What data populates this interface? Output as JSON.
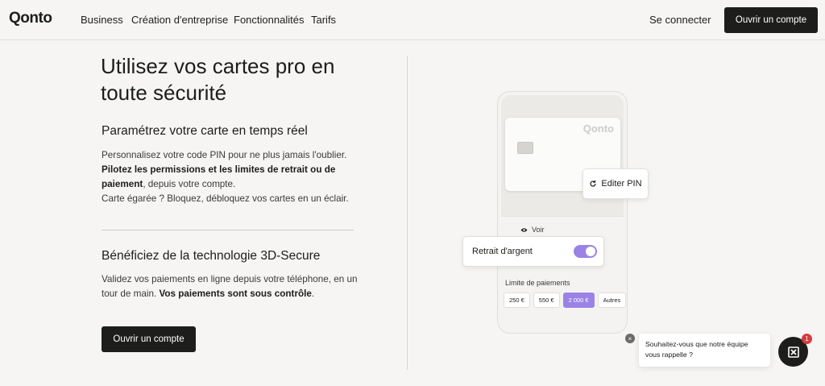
{
  "header": {
    "logo": "Qonto",
    "nav": [
      "Business",
      "Création d'entreprise",
      "Fonctionnalités",
      "Tarifs"
    ],
    "login": "Se connecter",
    "cta": "Ouvrir un compte"
  },
  "main": {
    "headline": "Utilisez vos cartes pro en toute sécurité",
    "section1": {
      "title": "Paramétrez votre carte en temps réel",
      "line1": "Personnalisez votre code PIN pour ne plus jamais l'oublier.",
      "bold": "Pilotez les permissions et les limites de retrait ou de paiement",
      "line2_rest": ", depuis votre compte.",
      "line3": "Carte égarée ? Bloquez, débloquez vos cartes en un éclair."
    },
    "section2": {
      "title": "Bénéficiez de la technologie 3D-Secure",
      "text": "Validez vos paiements en ligne depuis votre téléphone, en un tour de main. ",
      "bold": "Vos paiements sont sous contrôle",
      "end": "."
    },
    "cta": "Ouvrir un compte"
  },
  "illustration": {
    "card_logo": "Qonto",
    "pin_button": "Editer PIN",
    "voir": "Voir",
    "retrait_label": "Retrait d'argent",
    "retrait_enabled": true,
    "limit_label": "Limite de paiements",
    "amounts": [
      "250 €",
      "550 €",
      "2 000 €",
      "Autres"
    ],
    "selected_amount": "2 000 €"
  },
  "chat": {
    "message": "Souhaitez-vous que notre équipe vous rappelle ?",
    "badge": "1",
    "close": "×"
  },
  "colors": {
    "accent": "#9b83e6",
    "dark": "#1d1d1b",
    "background": "#f6f5f3",
    "badge": "#d43c3c"
  }
}
